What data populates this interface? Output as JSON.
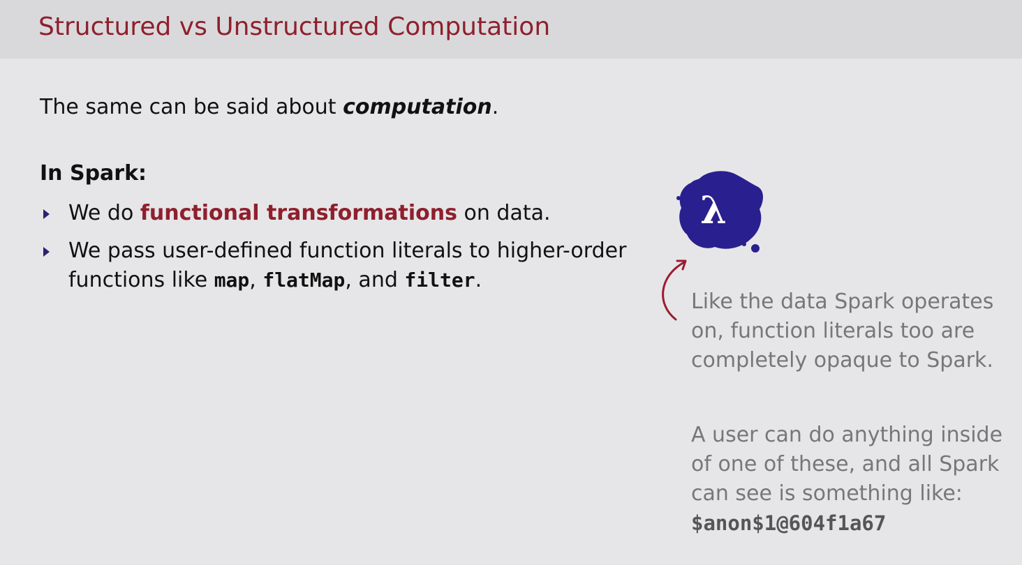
{
  "slide": {
    "title": "Structured vs Unstructured Computation",
    "intro": {
      "before": "The same can be said about ",
      "emphasis": "computation",
      "after": "."
    },
    "heading": "In Spark:",
    "bullets": [
      {
        "before": "We do ",
        "highlight": "functional transformations",
        "after": " on data."
      },
      {
        "before": "We pass user-defined function literals to higher-order functions like ",
        "code1": "map",
        "sep1": ", ",
        "code2": "flatMap",
        "sep2": ", and ",
        "code3": "filter",
        "after": "."
      }
    ]
  },
  "side_note": {
    "paragraph1": "Like the data Spark operates on, function literals too are completely opaque to Spark.",
    "paragraph2": "A user can do anything inside of one of these, and all Spark can see is something like:",
    "code": "$anon$1@604f1a67"
  },
  "icons": {
    "lambda_symbol": "λ",
    "lambda_blob_color": "#2a1f8f",
    "arrow_color": "#9b1b2e"
  },
  "colors": {
    "title": "#8f1f2d",
    "highlight": "#8f1f2d",
    "bullet_marker": "#2b2170",
    "note_text": "#777777"
  }
}
